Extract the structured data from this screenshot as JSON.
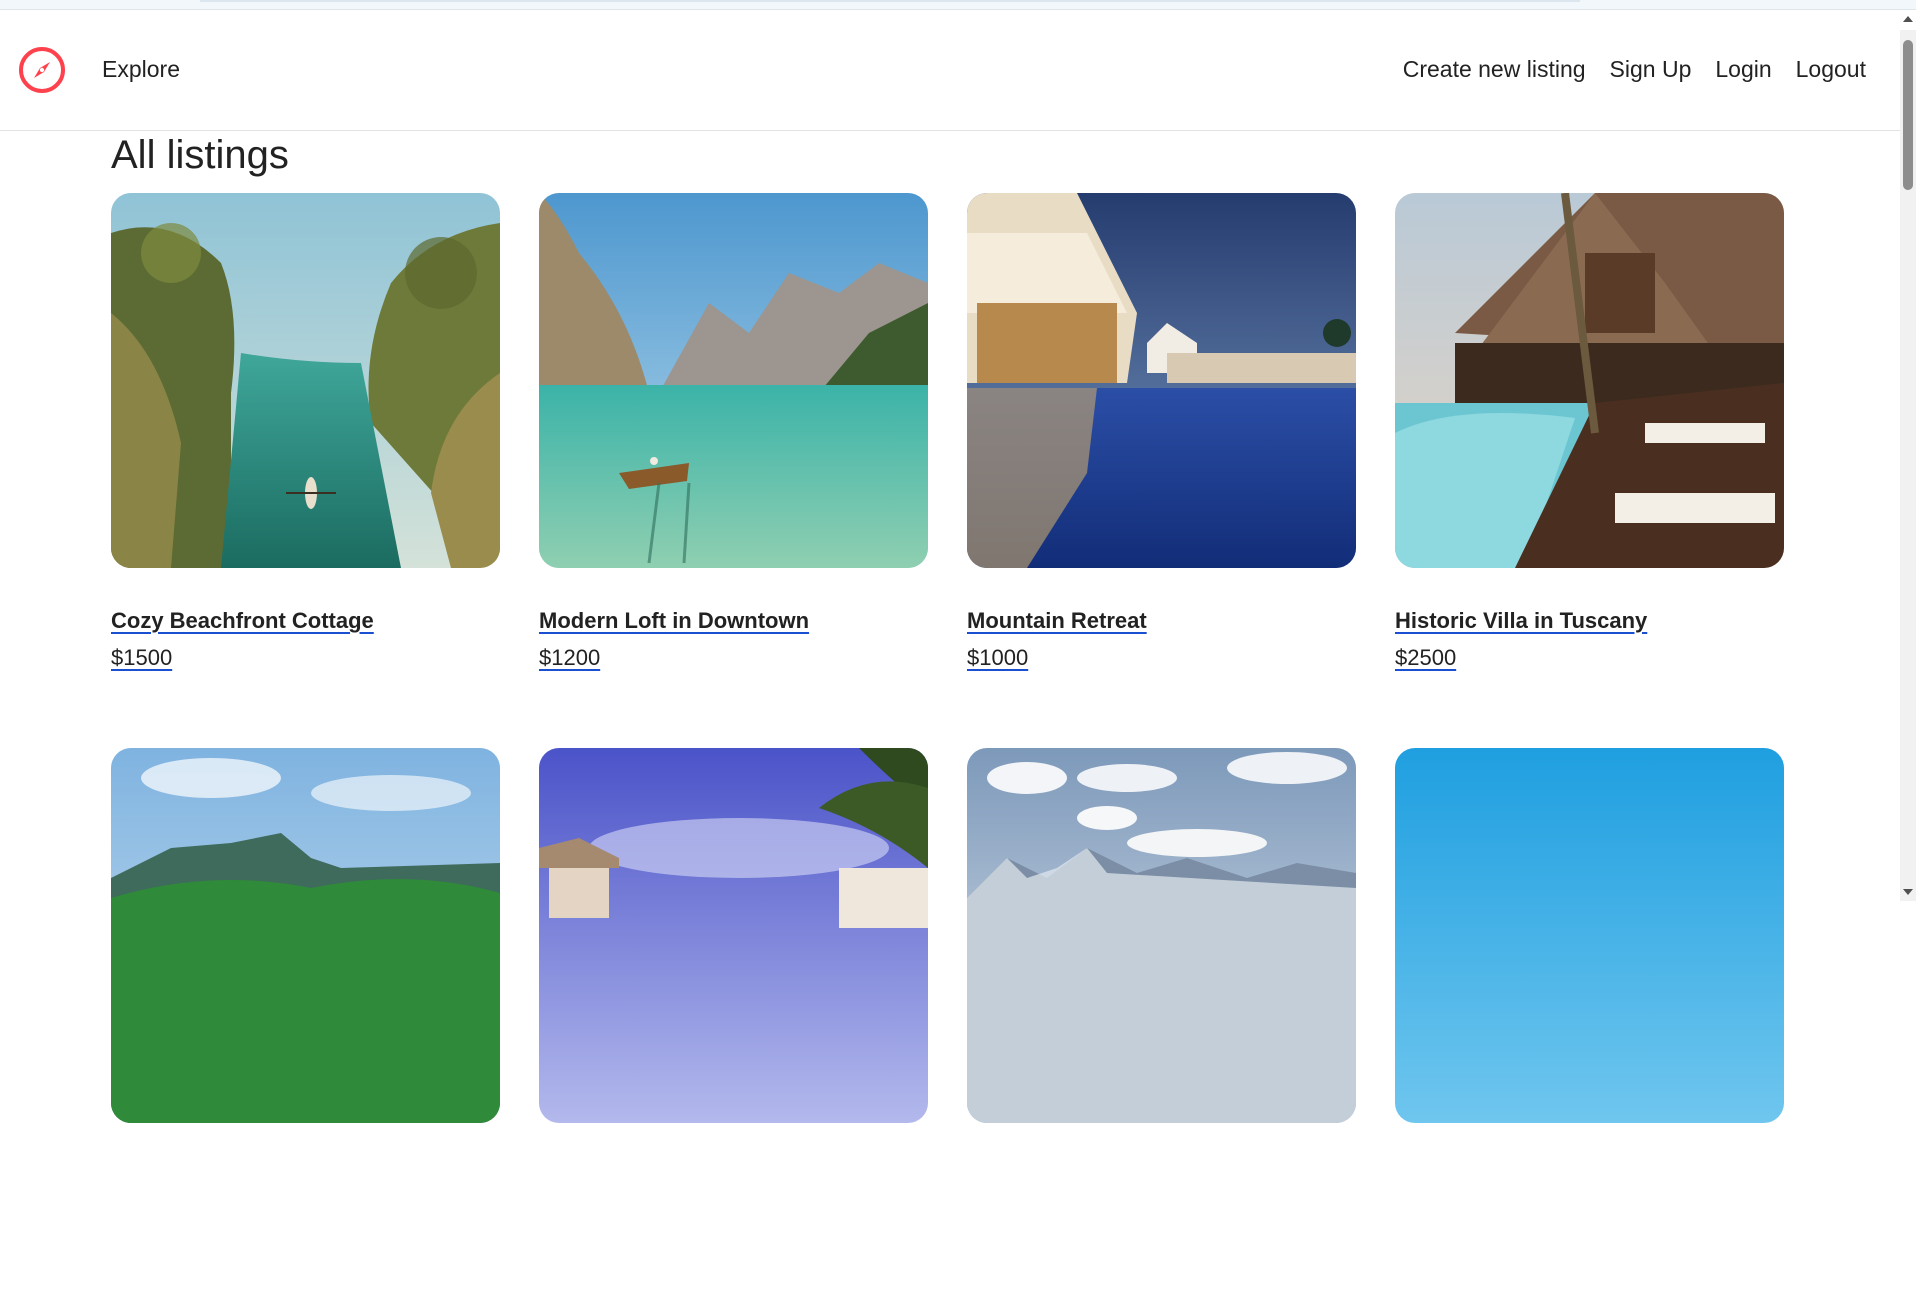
{
  "navbar": {
    "brand_icon": "compass-icon",
    "brand_color": "#fe424d",
    "explore_label": "Explore",
    "links": [
      "Create new listing",
      "Sign Up",
      "Login",
      "Logout"
    ]
  },
  "page": {
    "heading": "All listings"
  },
  "listings": [
    {
      "title": "Cozy Beachfront Cottage",
      "price": "$1500",
      "image": "tropical-river-canoe"
    },
    {
      "title": "Modern Loft in Downtown",
      "price": "$1200",
      "image": "mountain-lake-boat"
    },
    {
      "title": "Mountain Retreat",
      "price": "$1000",
      "image": "resort-pool-night"
    },
    {
      "title": "Historic Villa in Tuscany",
      "price": "$2500",
      "image": "villa-pool-deck"
    },
    {
      "image": "tropical-mountains-palms"
    },
    {
      "image": "beach-cabanas-palms"
    },
    {
      "image": "snowy-mountains-clouds"
    },
    {
      "image": "blue-sky-sea"
    }
  ],
  "colors": {
    "link_underline": "#1b4fd1",
    "text": "#222222"
  }
}
